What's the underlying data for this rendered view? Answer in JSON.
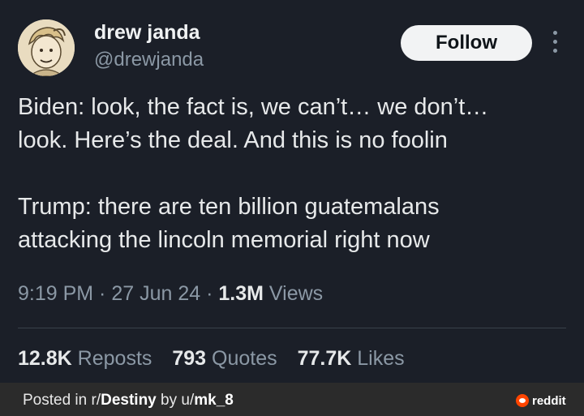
{
  "author": {
    "name": "drew janda",
    "handle": "@drewjanda",
    "avatar_icon": "cartoon-boy-avatar"
  },
  "actions": {
    "follow_label": "Follow",
    "more_icon": "more-vertical-icon"
  },
  "tweet": {
    "line1": "Biden: look, the fact is, we can’t… we don’t…",
    "line2": "look. Here’s the deal. And this is no foolin",
    "line3": "Trump: there are ten billion guatemalans",
    "line4": "attacking the lincoln memorial right now"
  },
  "meta": {
    "time": "9:19 PM",
    "sep1": " · ",
    "date": "27 Jun 24",
    "sep2": " · ",
    "views_count": "1.3M",
    "views_label": " Views"
  },
  "stats": {
    "reposts_count": "12.8K",
    "reposts_label": "Reposts",
    "quotes_count": "793",
    "quotes_label": "Quotes",
    "likes_count": "77.7K",
    "likes_label": "Likes"
  },
  "footer": {
    "prefix": "Posted in r/",
    "subreddit": "Destiny",
    "by": " by u/",
    "user": "mk_8",
    "badge": "reddit",
    "badge_icon": "reddit-icon"
  },
  "colors": {
    "background": "#1b1f28",
    "text": "#e7e9ea",
    "muted": "#8b98a5",
    "follow_bg": "#f2f3f4",
    "footer_bg": "#2b2b2b",
    "reddit_orange": "#ff4500"
  }
}
